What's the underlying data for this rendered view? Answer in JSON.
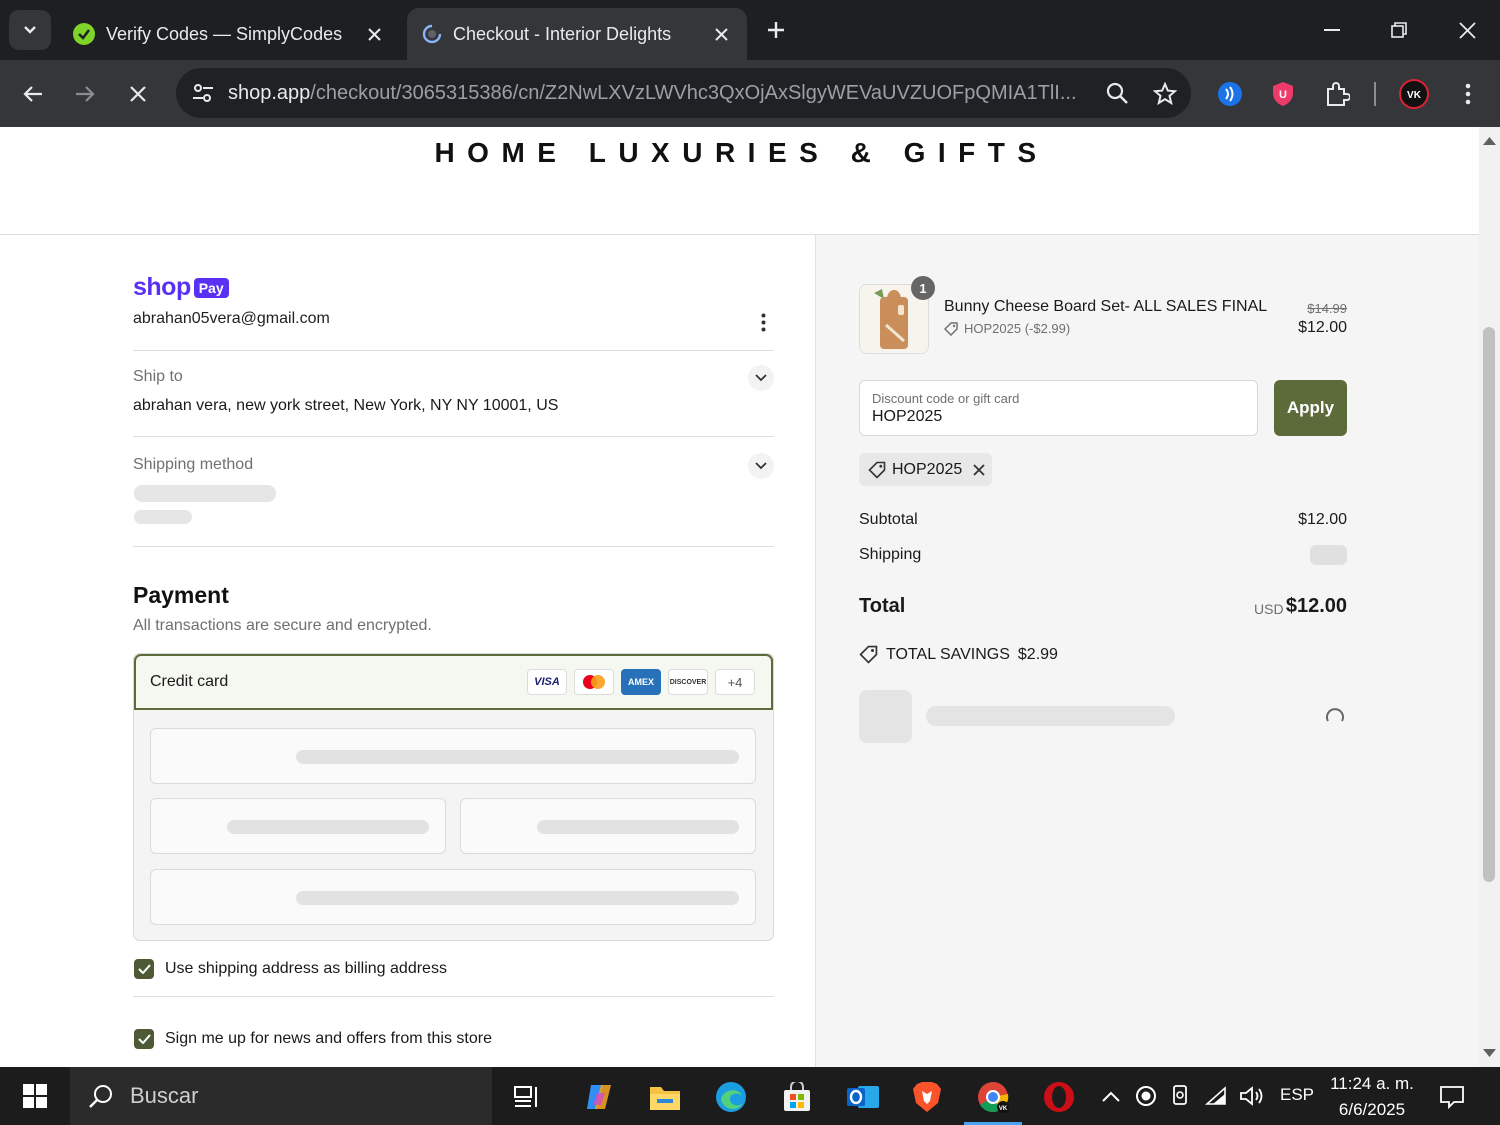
{
  "browser": {
    "tabs": [
      {
        "title": "Verify Codes — SimplyCodes",
        "active": false
      },
      {
        "title": "Checkout - Interior Delights",
        "active": true
      }
    ],
    "url_host": "shop.app",
    "url_path": "/checkout/3065315386/cn/Z2NwLXVzLWVhc3QxOjAxSlgyWEVaUVZUOFpQMIA1TlI..."
  },
  "store": {
    "name": "HOME LUXURIES & GIFTS"
  },
  "checkout": {
    "shop_pay": {
      "shop": "shop",
      "pay": "Pay"
    },
    "email": "abrahan05vera@gmail.com",
    "ship_to_label": "Ship to",
    "ship_to_address": "abrahan vera, new york street, New York, NY NY 10001, US",
    "shipping_method_label": "Shipping method",
    "payment_title": "Payment",
    "payment_subtitle": "All transactions are secure and encrypted.",
    "credit_card_label": "Credit card",
    "cards": [
      "VISA",
      "mastercard",
      "AMEX",
      "DISCOVER"
    ],
    "cards_more": "+4",
    "billing_checkbox": "Use shipping address as billing address",
    "news_checkbox": "Sign me up for news and offers from this store"
  },
  "summary": {
    "item": {
      "quantity": "1",
      "name": "Bunny Cheese Board Set- ALL SALES FINAL",
      "discount": "HOP2025 (-$2.99)",
      "original_price": "$14.99",
      "price": "$12.00"
    },
    "discount_placeholder": "Discount code or gift card",
    "discount_value": "HOP2025",
    "apply_label": "Apply",
    "applied_code": "HOP2025",
    "subtotal_label": "Subtotal",
    "subtotal_value": "$12.00",
    "shipping_label": "Shipping",
    "total_label": "Total",
    "currency": "USD",
    "total_value": "$12.00",
    "savings_label": "TOTAL SAVINGS",
    "savings_value": "$2.99"
  },
  "taskbar": {
    "search_placeholder": "Buscar",
    "language": "ESP",
    "time": "11:24 a. m.",
    "date": "6/6/2025"
  },
  "colors": {
    "accent_olive": "#5d6b3b",
    "shop_pay_purple": "#5a31f4",
    "chrome_dark": "#35363a"
  }
}
